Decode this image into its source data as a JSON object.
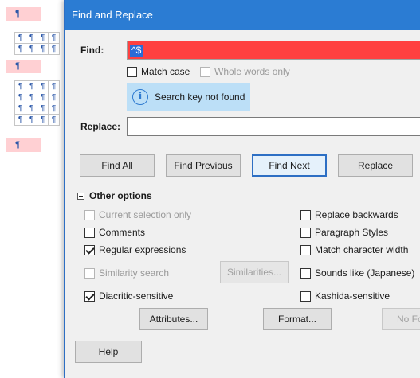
{
  "document": {
    "pilcrow": "¶"
  },
  "dialog": {
    "title": "Find and Replace",
    "find": {
      "label": "Find:",
      "value": "^$"
    },
    "match_case": {
      "label": "Match case",
      "checked": false
    },
    "whole_words": {
      "label": "Whole words only",
      "checked": false,
      "disabled": true
    },
    "info": "Search key not found",
    "replace": {
      "label": "Replace:",
      "value": ""
    },
    "buttons": {
      "find_all": "Find All",
      "find_previous": "Find Previous",
      "find_next": "Find Next",
      "replace": "Replace"
    },
    "other_options": {
      "label": "Other options",
      "left": [
        {
          "label": "Current selection only",
          "checked": false,
          "disabled": true
        },
        {
          "label": "Comments",
          "checked": false
        },
        {
          "label": "Regular expressions",
          "checked": true
        },
        {
          "label": "Similarity search",
          "checked": false,
          "disabled": true
        },
        {
          "label": "Diacritic-sensitive",
          "checked": true
        }
      ],
      "right": [
        {
          "label": "Replace backwards",
          "checked": false
        },
        {
          "label": "Paragraph Styles",
          "checked": false
        },
        {
          "label": "Match character width",
          "checked": false
        },
        {
          "label": "Sounds like (Japanese)",
          "checked": false
        },
        {
          "label": "Kashida-sensitive",
          "checked": false
        }
      ],
      "similarities_button": "Similarities...",
      "attributes_button": "Attributes...",
      "format_button": "Format...",
      "no_format_button": "No Fo"
    },
    "help_button": "Help"
  }
}
